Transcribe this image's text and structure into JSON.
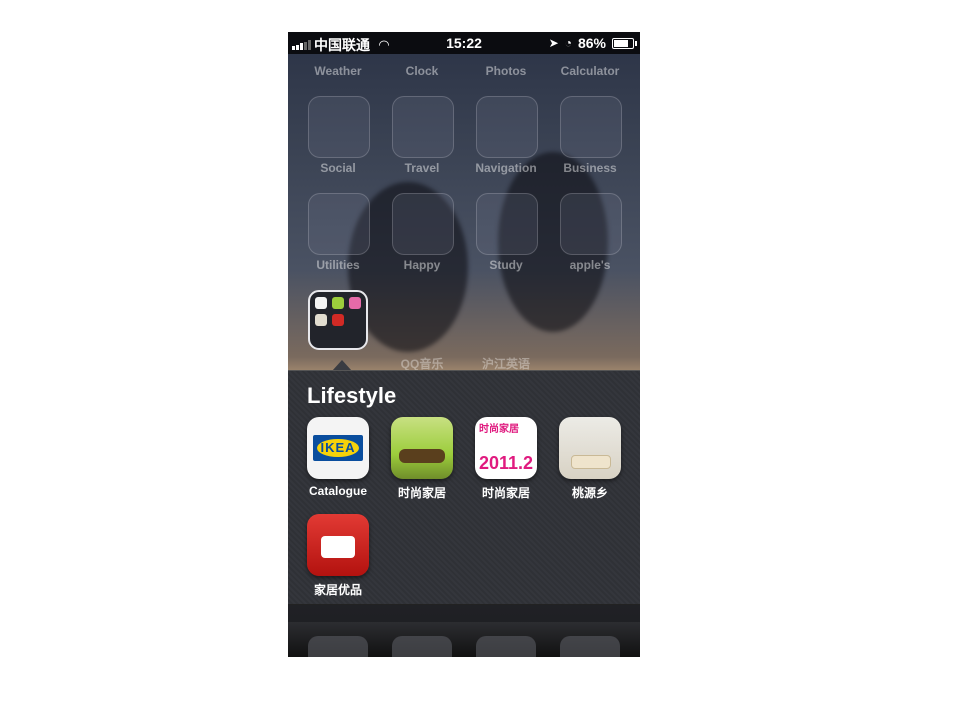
{
  "status_bar": {
    "carrier": "中国联通",
    "time": "15:22",
    "battery_percent": "86%",
    "battery_level": 0.86
  },
  "home_grid": {
    "row1_labels": [
      "Weather",
      "Clock",
      "Photos",
      "Calculator"
    ],
    "row2_labels": [
      "Social",
      "Travel",
      "Navigation",
      "Business"
    ],
    "row3_labels": [
      "Utilities",
      "Happy",
      "Study",
      "apple's"
    ],
    "row4_labels": [
      "QQ音乐",
      "沪江英语"
    ]
  },
  "folder": {
    "title": "Lifestyle",
    "apps": [
      {
        "label": "Catalogue",
        "icon": "ikea-icon"
      },
      {
        "label": "时尚家居",
        "icon": "green-room-icon"
      },
      {
        "label": "时尚家居",
        "icon": "magazine-icon"
      },
      {
        "label": "桃源乡",
        "icon": "living-room-icon"
      },
      {
        "label": "家居优品",
        "icon": "red-sofa-icon"
      }
    ],
    "ikea_text": "IKEA",
    "mag_text": "时尚家居",
    "mag_year": "2011.2"
  }
}
